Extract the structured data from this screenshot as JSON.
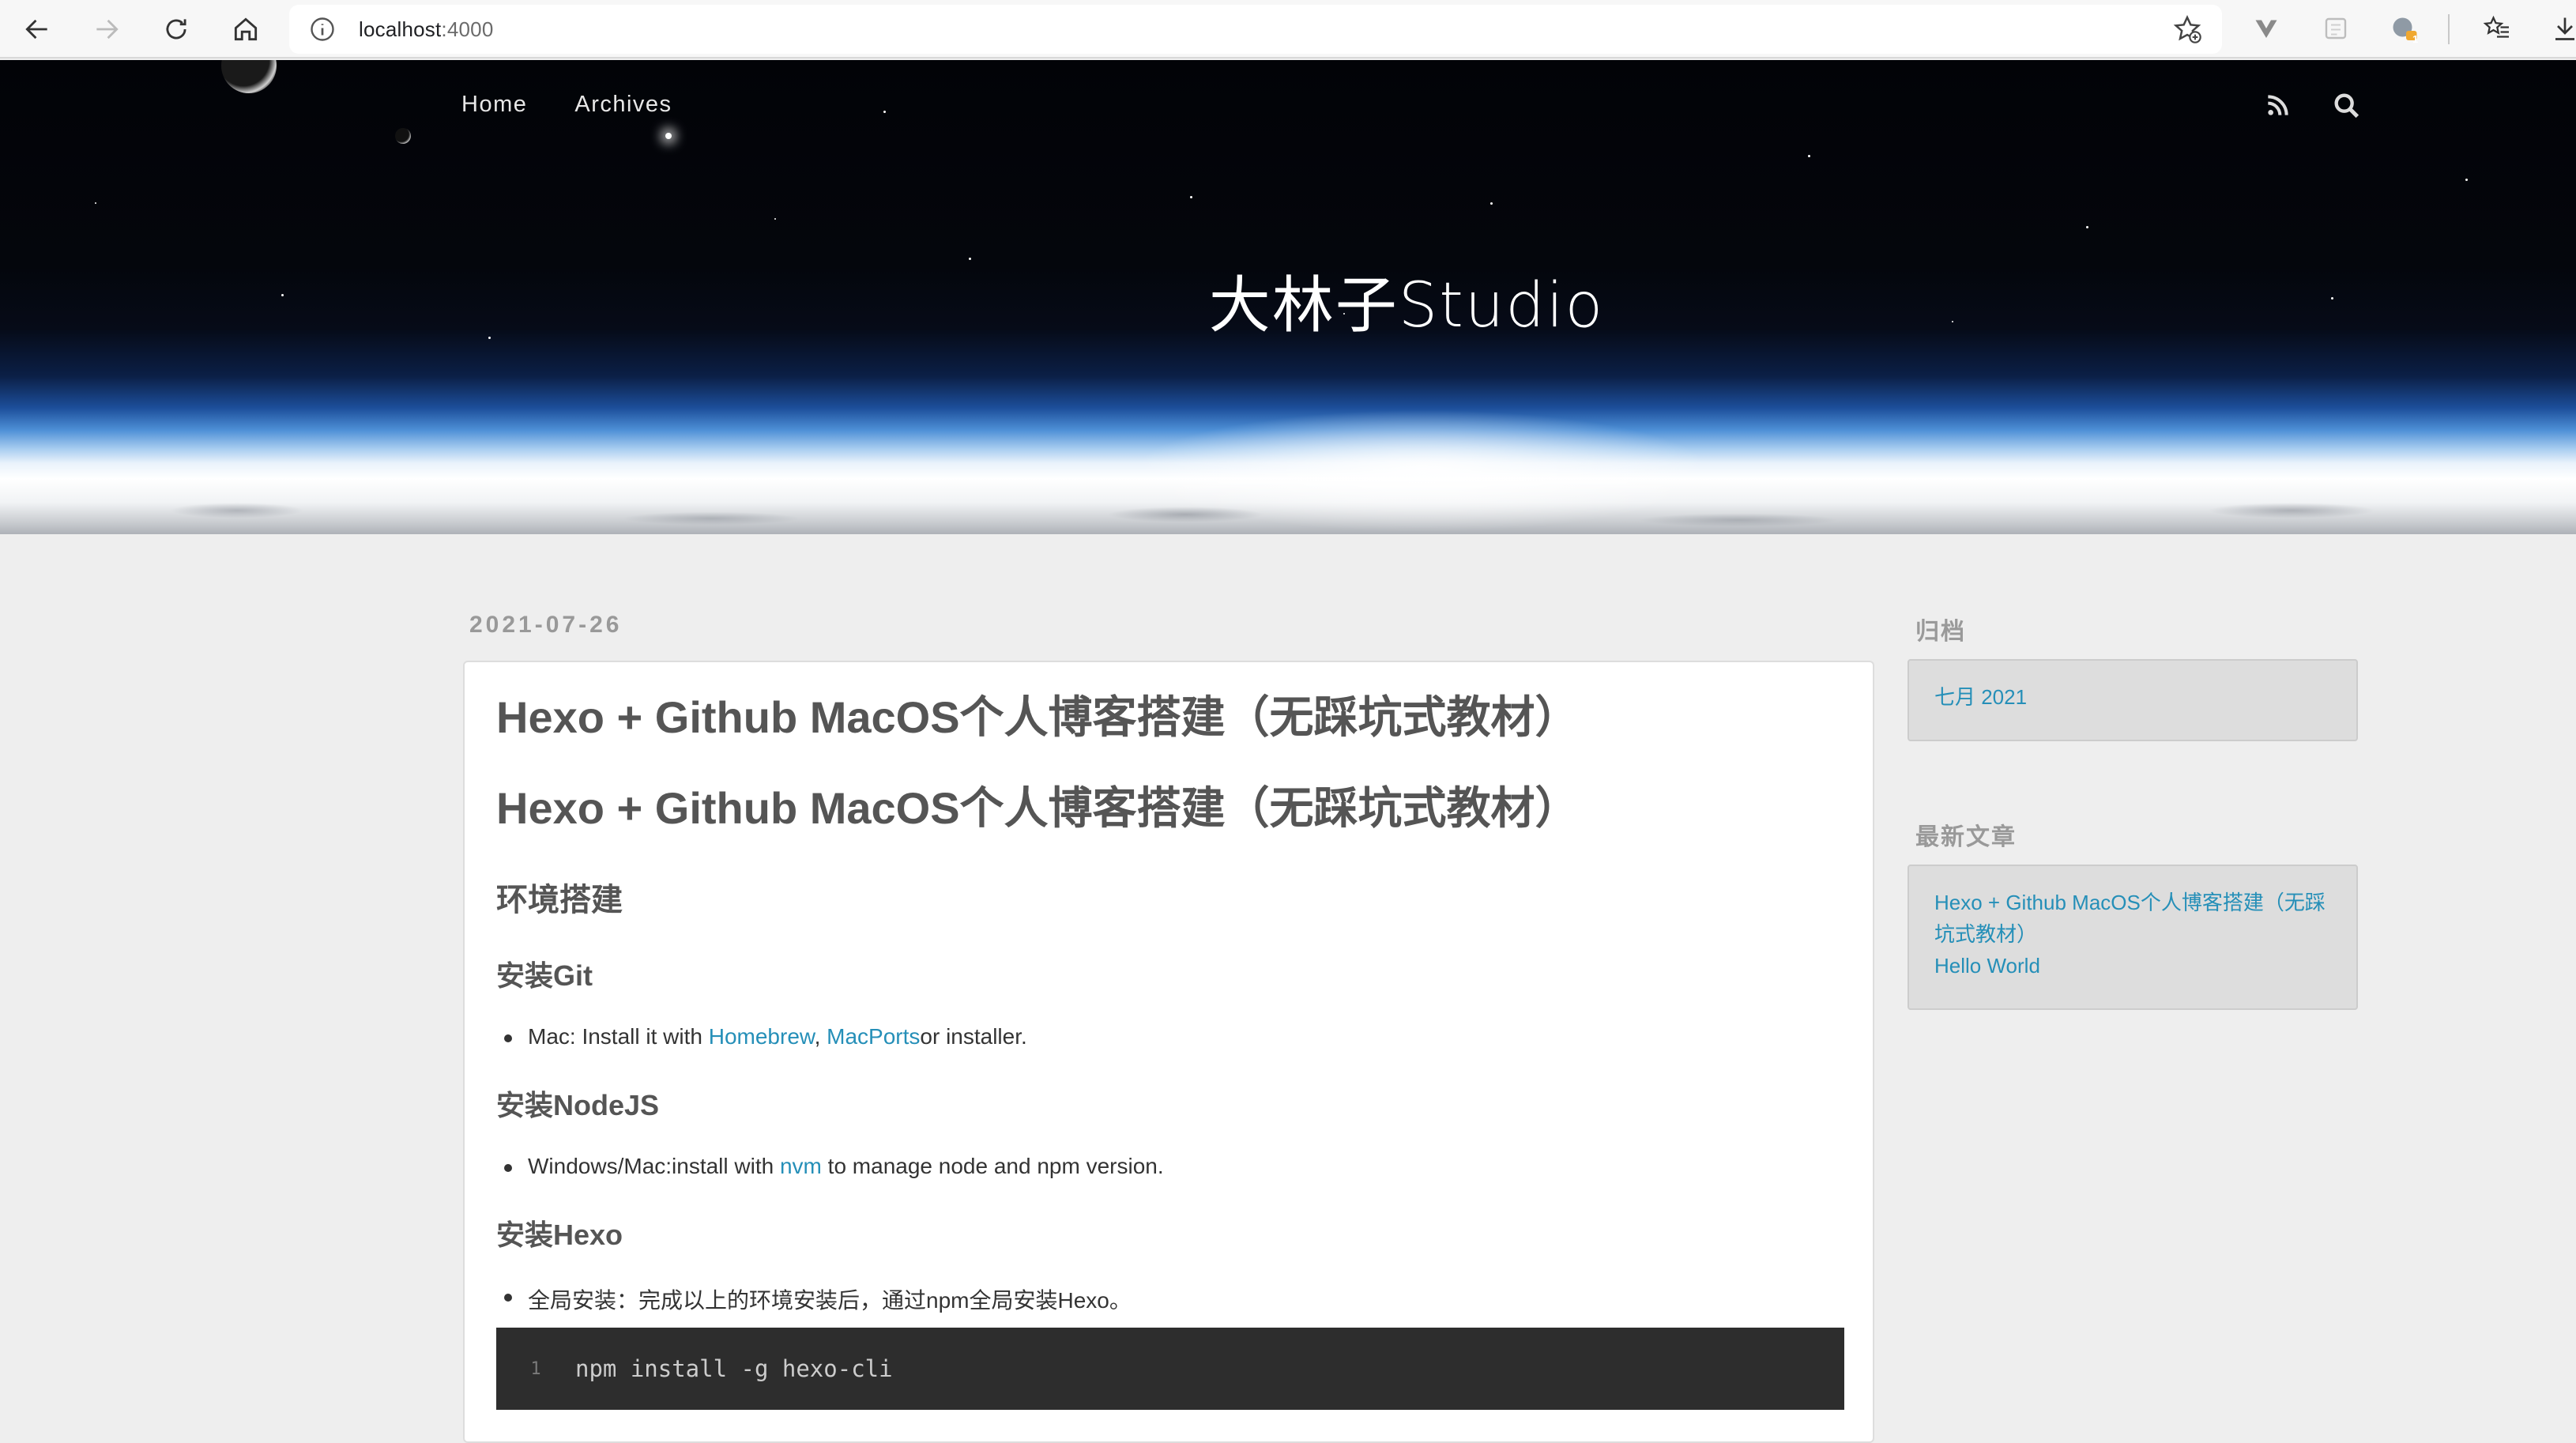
{
  "browser": {
    "url_host": "localhost",
    "url_port": ":4000",
    "icons": [
      "back-icon",
      "forward-icon",
      "reload-icon",
      "home-icon",
      "info-icon",
      "add-favorite-icon",
      "vue-devtools-icon",
      "extension-icon",
      "profile-extension-icon",
      "favorites-icon",
      "downloads-icon"
    ],
    "extension_badge": "1"
  },
  "site": {
    "nav": [
      "Home",
      "Archives"
    ],
    "title": "大林子Studio",
    "icons": [
      "rss-icon",
      "search-icon"
    ]
  },
  "post": {
    "date": "2021-07-26",
    "title": "Hexo + Github MacOS个人博客搭建（无踩坑式教材）",
    "h1": "Hexo + Github MacOS个人博客搭建（无踩坑式教材）",
    "section_env": "环境搭建",
    "git": {
      "heading": "安装Git",
      "prefix": "Mac: Install it with ",
      "link1": "Homebrew",
      "sep": ", ",
      "link2": "MacPorts",
      "suffix": "or installer."
    },
    "node": {
      "heading": "安装NodeJS",
      "prefix": "Windows/Mac:install with ",
      "link": "nvm",
      "suffix": " to manage node and npm version."
    },
    "hexo": {
      "heading": "安装Hexo",
      "text": "全局安装：完成以上的环境安装后，通过npm全局安装Hexo。",
      "code_line_no": "1",
      "code": "npm install -g hexo-cli"
    }
  },
  "sidebar": {
    "archive_heading": "归档",
    "archives": [
      "七月 2021"
    ],
    "recent_heading": "最新文章",
    "recent": [
      "Hexo + Github MacOS个人博客搭建（无踩坑式教材）",
      "Hello World"
    ]
  },
  "colors": {
    "link": "#258fb8",
    "background": "#eeeeee",
    "code_bg": "#2d2d2d"
  }
}
